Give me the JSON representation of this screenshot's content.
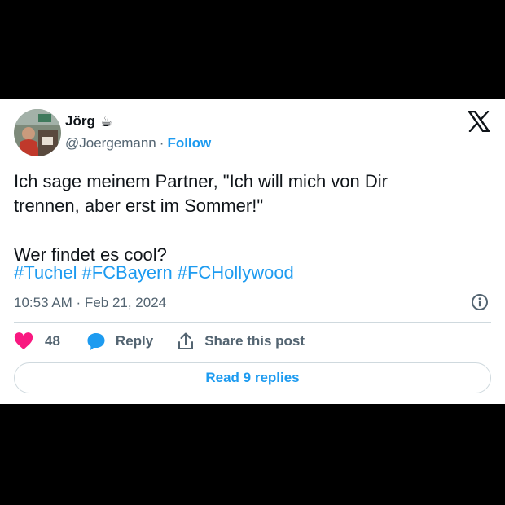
{
  "author": {
    "name": "Jörg",
    "emoji": "☕",
    "handle": "@Joergemann",
    "separator": "·",
    "follow_label": "Follow"
  },
  "tweet": {
    "text": "Ich sage meinem Partner, \"Ich will mich von Dir\ntrennen, aber erst im Sommer!\"\n\nWer findet es cool?",
    "hashtags": [
      "#Tuchel",
      "#FCBayern",
      "#FCHollywood"
    ],
    "timestamp": "10:53 AM · Feb 21, 2024"
  },
  "actions": {
    "likes_count": "48",
    "reply_label": "Reply",
    "share_label": "Share this post"
  },
  "replies_button": "Read 9 replies",
  "icons": {
    "brand": "x-logo-icon",
    "info": "info-icon",
    "like": "heart-icon",
    "reply": "speech-bubble-icon",
    "share": "share-icon"
  },
  "colors": {
    "accent": "#1d9bf0",
    "like": "#f91880",
    "text": "#0f1419",
    "muted": "#536471"
  }
}
